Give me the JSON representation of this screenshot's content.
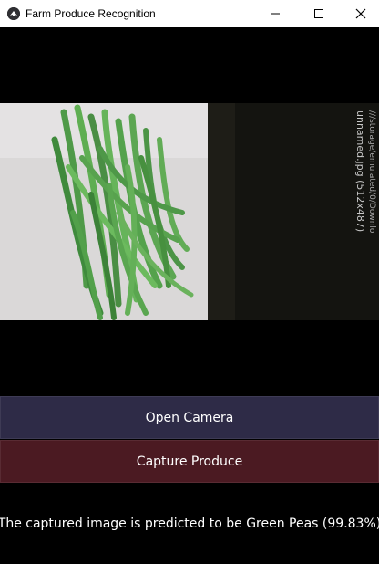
{
  "window": {
    "title": "Farm Produce Recognition"
  },
  "icons": {
    "app": "kivy-app-icon",
    "minimize": "minimize-icon",
    "maximize": "maximize-icon",
    "close": "close-icon"
  },
  "buttons": {
    "open_camera": "Open Camera",
    "capture_produce": "Capture Produce"
  },
  "result": {
    "text": "The captured image is predicted to be Green Peas (99.83%)"
  },
  "colors": {
    "open_camera_bg": "#2e2b47",
    "capture_produce_bg": "#4b1a22",
    "background": "#000000",
    "titlebar": "#ffffff"
  }
}
